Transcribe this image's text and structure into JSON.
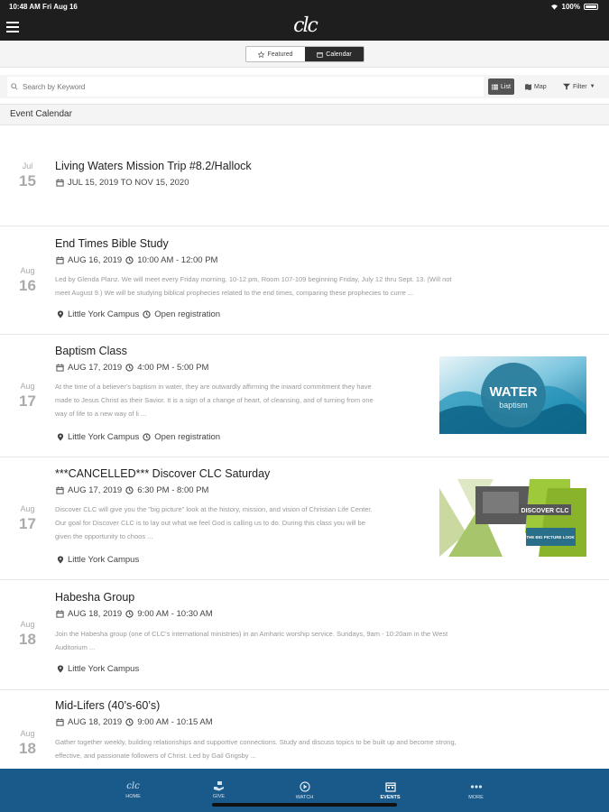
{
  "status": {
    "time": "10:48 AM  Fri Aug 16",
    "battery": "100%"
  },
  "header": {
    "logo": "clc"
  },
  "segments": [
    {
      "label": "Featured",
      "icon": "star-icon",
      "active": false
    },
    {
      "label": "Calendar",
      "icon": "calendar-icon",
      "active": true
    }
  ],
  "search": {
    "placeholder": "Search by Keyword",
    "list_label": "List",
    "map_label": "Map",
    "filter_label": "Filter"
  },
  "section": {
    "title": "Event Calendar"
  },
  "events": [
    {
      "month": "Jul",
      "day": "15",
      "title": "Living Waters Mission Trip #8.2/Hallock",
      "datetime": "JUL 15, 2019 TO NOV 15, 2020"
    },
    {
      "month": "Aug",
      "day": "16",
      "title": "End Times Bible Study",
      "date": "AUG 16, 2019",
      "time": "10:00 AM - 12:00 PM",
      "desc_1": "Led by Glenda Planz. We will meet every Friday morning, 10-12 pm, Room 107-109 beginning Friday, July 12 thru Sept. 13. (Will not",
      "desc_2": "meet August 9.) We will be studying biblical prophecies related to the end times, comparing these prophecies to curre ...",
      "location": "Little York Campus",
      "registration": "Open registration"
    },
    {
      "month": "Aug",
      "day": "17",
      "title": "Baptism Class",
      "date": "AUG 17, 2019",
      "time": "4:00 PM - 5:00 PM",
      "desc_1": "At the time of a believer's baptism in water, they are outwardly affirming the inward commitment they have",
      "desc_2": "made to Jesus Christ as their Savior. It is a sign of a change of heart, of cleansing, and of turning from one",
      "desc_3": "way of life to a new way of li ...",
      "location": "Little York Campus",
      "registration": "Open registration",
      "image": {
        "word1": "WATER",
        "word2": "baptism"
      }
    },
    {
      "month": "Aug",
      "day": "17",
      "title": "***CANCELLED*** Discover CLC Saturday",
      "date": "AUG 17, 2019",
      "time": "6:30 PM - 8:00 PM",
      "desc_1": "Discover CLC will give you the \"big picture\" look at the history, mission, and vision of Christian Life Center.",
      "desc_2": "Our goal for Discover CLC is to lay out what we feel God is calling us to do. During this class you will be",
      "desc_3": "given the opportunity to choos ...",
      "location": "Little York Campus",
      "image": {
        "word1": "DISCOVER CLC",
        "word2": "THE BIG PICTURE LOOK"
      }
    },
    {
      "month": "Aug",
      "day": "18",
      "title": "Habesha Group",
      "date": "AUG 18, 2019",
      "time": "9:00 AM - 10:30 AM",
      "desc_1": "Join the Habesha group (one of CLC's international ministries) in an Amharic worship service. Sundays, 9am - 10:20am in the West",
      "desc_2": "Auditorium ...",
      "location": "Little York Campus"
    },
    {
      "month": "Aug",
      "day": "18",
      "title": "Mid-Lifers (40’s-60’s)",
      "date": "AUG 18, 2019",
      "time": "9:00 AM - 10:15 AM",
      "desc_1": "Gather together weekly, building relationships and supportive connections. Study and discuss topics to be built up and become strong,",
      "desc_2": "effective, and passionate followers of Christ. Led by Gail Grigsby ..."
    }
  ],
  "tabs": [
    {
      "label": "HOME",
      "icon": "clc-logo-icon",
      "active": false
    },
    {
      "label": "GIVE",
      "icon": "give-hand-icon",
      "active": false
    },
    {
      "label": "WATCH",
      "icon": "play-icon",
      "active": false
    },
    {
      "label": "EVENTS",
      "icon": "calendar-icon",
      "active": true
    },
    {
      "label": "MORE",
      "icon": "more-dots-icon",
      "active": false
    }
  ],
  "colors": {
    "tabbar": "#1a5a8a",
    "topbar": "#1e1e1e",
    "water": "#1b8fb5",
    "discover_green": "#9ec93b"
  }
}
